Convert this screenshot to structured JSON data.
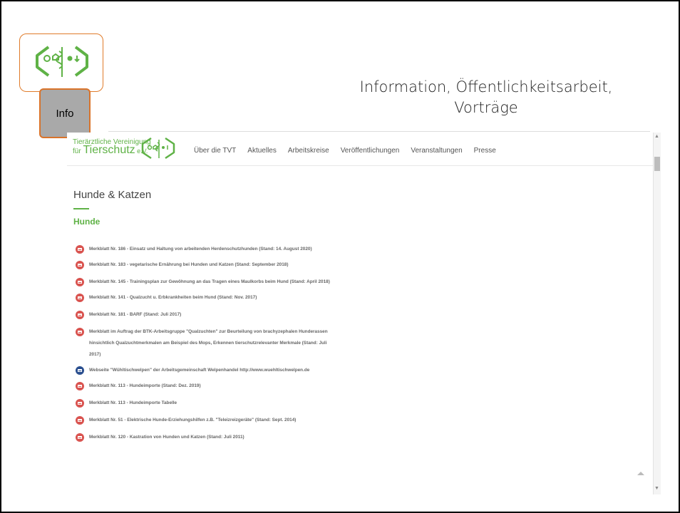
{
  "slide": {
    "title": "Information, Öffentlichkeitsarbeit, Vorträge",
    "info_label": "Info"
  },
  "site": {
    "brand_line1": "Tierärztliche Vereinigung",
    "brand_line2_prefix": "für ",
    "brand_line2_main": "Tierschutz",
    "brand_line2_suffix": " e.V.",
    "nav": [
      "Über die TVT",
      "Aktuelles",
      "Arbeitskreise",
      "Veröffentlichungen",
      "Veranstaltungen",
      "Presse"
    ],
    "page_heading": "Hunde & Katzen",
    "section_heading": "Hunde",
    "items": [
      {
        "text": "Merkblatt Nr. 186 - Einsatz und Haltung von arbeitenden Herdenschutzhunden (Stand: 14. August 2020)",
        "icon": "pdf-icon"
      },
      {
        "text": "Merkblatt Nr. 183 - vegetarische Ernährung bei Hunden und Katzen (Stand: September 2018)",
        "icon": "pdf-icon"
      },
      {
        "text": "Merkblatt Nr. 145 - Trainingsplan zur Gewöhnung an das Tragen eines Maulkorbs beim Hund (Stand: April 2018)",
        "icon": "pdf-icon"
      },
      {
        "text": "Merkblatt Nr. 141 - Qualzucht u. Erbkrankheiten beim Hund (Stand: Nov. 2017)",
        "icon": "pdf-icon"
      },
      {
        "text": "Merkblatt Nr. 181 - BARF (Stand: Juli 2017)",
        "icon": "pdf-icon"
      },
      {
        "text": "Merkblatt im Auftrag der BTK-Arbeitsgruppe \"Qualzuchten\" zur Beurteilung von brachyzephalen Hunderassen hinsichtlich Qualzuchtmerkmalen am Beispiel des Mops, Erkennen tierschutzrelevanter Merkmale (Stand: Juli 2017)",
        "icon": "pdf-icon"
      },
      {
        "text": "Webseite \"Wühltischwelpen\" der Arbeitsgemeinschaft Welpenhandel http://www.wuehltischwelpen.de",
        "icon": "web-icon"
      },
      {
        "text": "Merkblatt Nr. 113 - Hundeimporte (Stand: Dez. 2019)",
        "icon": "pdf-icon"
      },
      {
        "text": "Merkblatt Nr. 113 - Hundeimporte Tabelle",
        "icon": "pdf-icon"
      },
      {
        "text": "Merkblatt Nr. 51 - Elektrische Hunde-Erziehungshilfen z.B. \"Teleizreizgeräte\" (Stand: Sept. 2014)",
        "icon": "pdf-icon"
      },
      {
        "text": "Merkblatt Nr. 120 - Kastration von Hunden und Katzen (Stand: Juli 2011)",
        "icon": "pdf-icon"
      }
    ]
  },
  "colors": {
    "brand_green": "#5fb246",
    "pdf_red": "#d9534f",
    "web_blue": "#2a4f8f",
    "info_border": "#d9732a"
  }
}
